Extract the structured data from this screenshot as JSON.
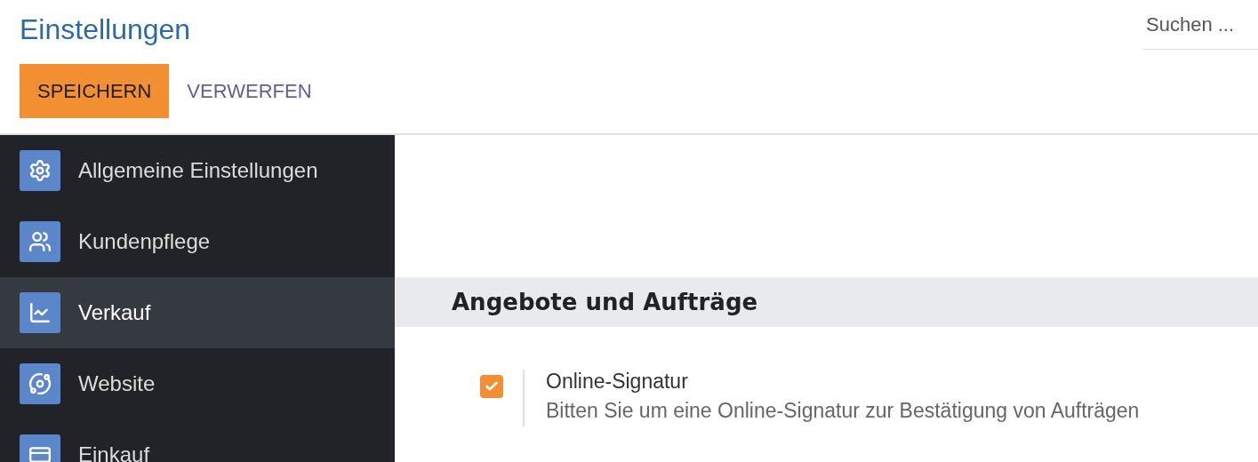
{
  "title": "Einstellungen",
  "search": {
    "placeholder": "Suchen ..."
  },
  "buttons": [
    {
      "label": "SPEICHERN",
      "kind": "primary"
    },
    {
      "label": "VERWERFEN",
      "kind": "link"
    }
  ],
  "sidebar": {
    "items": [
      {
        "label": "Allgemeine Einstellungen",
        "selected": false
      },
      {
        "label": "Kundenpflege",
        "selected": false
      },
      {
        "label": "Verkauf",
        "selected": true
      },
      {
        "label": "Website",
        "selected": false
      },
      {
        "label": "Einkauf",
        "selected": false
      }
    ]
  },
  "section": {
    "title": "Angebote und Aufträge",
    "settings": [
      {
        "label": "Online-Signatur",
        "description": "Bitten Sie um eine Online-Signatur zur Bestätigung von Aufträgen",
        "checked": true
      }
    ]
  }
}
